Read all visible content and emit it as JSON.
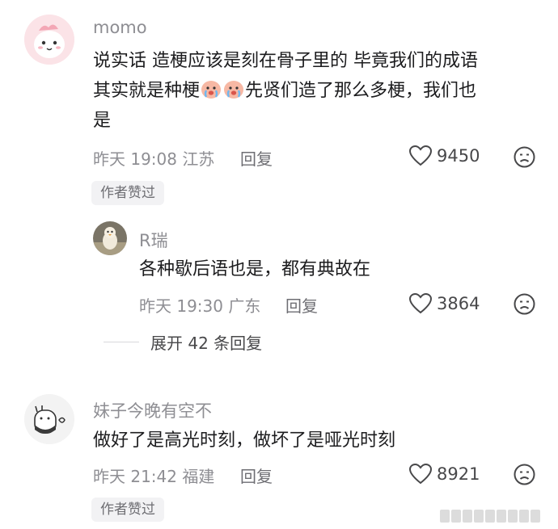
{
  "comments": [
    {
      "username": "momo",
      "text_line1": "说实话 造梗应该是刻在骨子里的 毕竟我们的成语",
      "text_line2_before": "其实就是种梗",
      "text_line2_after": "先贤们造了那么多梗，我们也",
      "text_line3": "是",
      "time": "昨天 19:08 江苏",
      "reply_label": "回复",
      "likes": "9450",
      "badge": "作者赞过"
    },
    {
      "username": "R瑞",
      "text": "各种歇后语也是，都有典故在",
      "time": "昨天 19:30 广东",
      "reply_label": "回复",
      "likes": "3864"
    },
    {
      "username": "妹子今晚有空不",
      "text": "做好了是高光时刻，做坏了是哑光时刻",
      "time": "昨天 21:42 福建",
      "reply_label": "回复",
      "likes": "8921",
      "badge": "作者赞过"
    }
  ],
  "expand_replies": "展开 42 条回复",
  "icons": {
    "like": "heart-outline-icon",
    "dislike": "unhappy-face-icon",
    "emoji": "crying-face-emoji"
  },
  "colors": {
    "text": "#1c1c1e",
    "meta": "#8e8e93",
    "badge_bg": "#f2f2f4"
  }
}
